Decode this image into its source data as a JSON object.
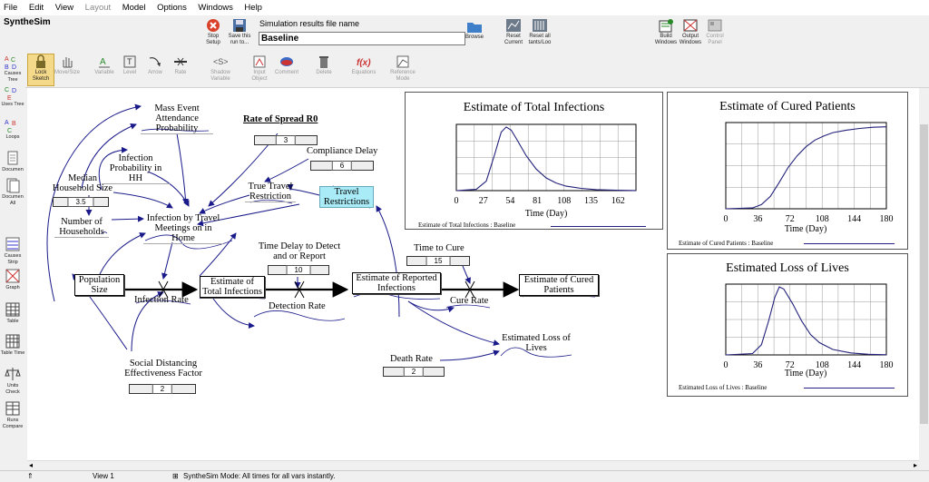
{
  "menu": [
    "File",
    "Edit",
    "View",
    "Layout",
    "Model",
    "Options",
    "Windows",
    "Help"
  ],
  "app_title": "SyntheSim",
  "toolbar1": {
    "stop": "Stop Setup",
    "save": "Save this run to...",
    "file_label": "Simulation results file name",
    "file_value": "Baseline",
    "browse": "Browse",
    "reset_current": "Reset Current",
    "reset_all": "Reset all tants/Loo",
    "build_windows": "Build Windows",
    "output_windows": "Output Windows",
    "control_panel": "Control Panel"
  },
  "toolbar2": {
    "lock": "Lock Sketch",
    "move": "Move/Size",
    "variable": "Variable",
    "level": "Level",
    "arrow": "Arrow",
    "rate": "Rate",
    "shadow": "Shadow Variable",
    "io": "Input Object",
    "comment": "Comment",
    "delete": "Delete",
    "equations": "Equations",
    "reference": "Reference Mode"
  },
  "sidebar": [
    "Causes Tree",
    "Uses Tree",
    "Loops",
    "Documen",
    "Documen All",
    "Causes Strip",
    "Graph",
    "Table",
    "Table Time",
    "Units Check",
    "Runs Compare"
  ],
  "diagram": {
    "mass_event": "Mass Event Attendance Probability",
    "rate_spread": "Rate of Spread R0",
    "rate_spread_val": "3",
    "infection_hh": "Infection Probability in HH",
    "compliance": "Compliance Delay",
    "compliance_val": "6",
    "median_hh": "Median Household Size",
    "median_hh_val": "3.5",
    "true_travel": "True Travel Restriction",
    "travel_restr": "Travel Restrictions",
    "num_hh": "Number of Households",
    "inf_travel": "Infection by Travel Meetings on in Home",
    "time_delay": "Time Delay to Detect and or Report",
    "time_delay_val": "10",
    "time_cure": "Time to Cure",
    "time_cure_val": "15",
    "pop_size": "Population Size",
    "est_total": "Estimate of Total Infections",
    "est_reported": "Estimate of Reported Infections",
    "est_cured": "Estimate of Cured Patients",
    "infection_rate": "Infection Rate",
    "detection_rate": "Detection Rate",
    "cure_rate": "Cure Rate",
    "est_loss": "Estimated Loss of Lives",
    "death_rate": "Death Rate",
    "death_rate_val": "2",
    "social": "Social Distancing Effectiveness Factor",
    "social_val": "2"
  },
  "chart_data": [
    {
      "type": "line",
      "title": "Estimate of Total Infections",
      "xlabel": "Time (Day)",
      "xticks": [
        "0",
        "27",
        "54",
        "81",
        "108",
        "135",
        "162"
      ],
      "xlim": [
        0,
        180
      ],
      "legend": "Estimate of Total Infections : Baseline",
      "grid": true,
      "series": [
        {
          "x": [
            0,
            20,
            30,
            38,
            45,
            50,
            55,
            60,
            70,
            80,
            90,
            100,
            110,
            125,
            140,
            160,
            180
          ],
          "y": [
            0,
            0.02,
            0.15,
            0.55,
            0.92,
            1.0,
            0.95,
            0.82,
            0.55,
            0.34,
            0.2,
            0.12,
            0.07,
            0.035,
            0.015,
            0.005,
            0.002
          ]
        }
      ]
    },
    {
      "type": "line",
      "title": "Estimate of Cured Patients",
      "xlabel": "Time (Day)",
      "xticks": [
        "0",
        "36",
        "72",
        "108",
        "144",
        "180"
      ],
      "xlim": [
        0,
        180
      ],
      "legend": "Estimate of Cured Patients : Baseline",
      "grid": true,
      "series": [
        {
          "x": [
            0,
            30,
            40,
            50,
            60,
            70,
            80,
            90,
            100,
            110,
            120,
            135,
            150,
            165,
            180
          ],
          "y": [
            0,
            0.01,
            0.05,
            0.15,
            0.32,
            0.5,
            0.64,
            0.75,
            0.83,
            0.88,
            0.92,
            0.95,
            0.97,
            0.985,
            0.99
          ]
        }
      ]
    },
    {
      "type": "line",
      "title": "Estimated Loss of Lives",
      "xlabel": "Time (Day)",
      "xticks": [
        "0",
        "36",
        "72",
        "108",
        "144",
        "180"
      ],
      "xlim": [
        0,
        180
      ],
      "legend": "Estimated Loss of Lives : Baseline",
      "grid": true,
      "series": [
        {
          "x": [
            0,
            30,
            40,
            48,
            55,
            60,
            65,
            75,
            85,
            95,
            105,
            120,
            140,
            160,
            180
          ],
          "y": [
            0,
            0.02,
            0.15,
            0.5,
            0.85,
            1.0,
            0.97,
            0.75,
            0.5,
            0.3,
            0.18,
            0.08,
            0.03,
            0.01,
            0.003
          ]
        }
      ]
    }
  ],
  "status": {
    "view": "View 1",
    "mode": "SyntheSim Mode: All times for all vars instantly."
  }
}
